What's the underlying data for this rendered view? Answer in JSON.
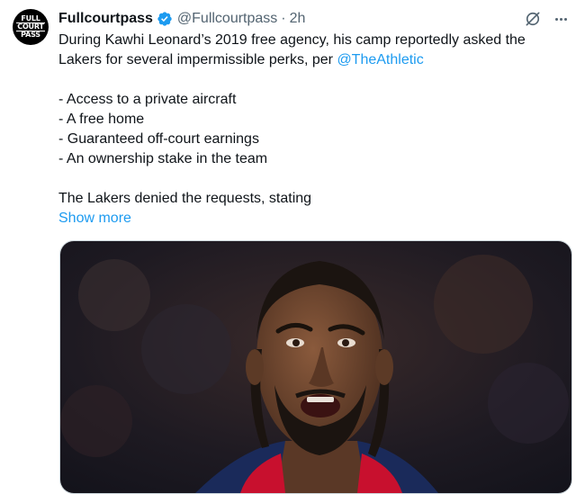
{
  "tweet": {
    "avatar_text": [
      "FULL",
      "COURT",
      "PASS"
    ],
    "display_name": "Fullcourtpass",
    "handle": "@Fullcourtpass",
    "separator": "·",
    "time": "2h",
    "line1": "During Kawhi Leonard’s 2019 free agency, his camp reportedly asked the",
    "line2_prefix": "Lakers for several impermissible perks, per ",
    "mention": "@TheAthletic",
    "bullets": [
      "- Access to a private aircraft",
      "- A free home",
      "- Guaranteed off-court earnings",
      "- An ownership stake in the team"
    ],
    "truncated_text": "The Lakers denied the requests, stating",
    "show_more": "Show more"
  },
  "icons": {
    "verified": "verified-badge-icon",
    "grok": "grok-icon",
    "more": "more-options-icon"
  },
  "colors": {
    "link": "#1d9bf0",
    "secondary_text": "#536471",
    "verified": "#1d9bf0"
  }
}
